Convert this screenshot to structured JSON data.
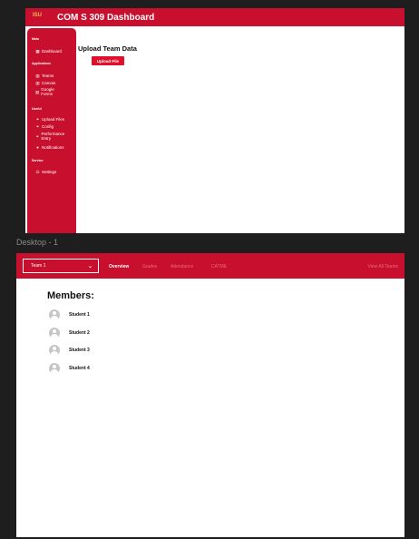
{
  "dashboard": {
    "logo_text": "ISU",
    "title": "COM S 309 Dashboard",
    "sidebar": {
      "sections": [
        {
          "label": "Main",
          "items": [
            {
              "icon": "grid-icon",
              "glyph": "▦",
              "label": "Dashboard"
            }
          ]
        },
        {
          "label": "Applications",
          "items": [
            {
              "icon": "bar-chart-icon",
              "glyph": "▥",
              "label": "Teams"
            },
            {
              "icon": "bar-chart-icon",
              "glyph": "▥",
              "label": "Canvas"
            },
            {
              "icon": "bar-chart-icon",
              "glyph": "▥",
              "label": "Google Forms"
            }
          ]
        },
        {
          "label": "Useful",
          "items": [
            {
              "icon": "link-icon",
              "glyph": "⚭",
              "label": "Upload Files"
            },
            {
              "icon": "link-icon",
              "glyph": "⚭",
              "label": "Config"
            },
            {
              "icon": "link-icon",
              "glyph": "⚭",
              "label": "Performance Entry"
            },
            {
              "icon": "bell-icon",
              "glyph": "●",
              "label": "Notifications"
            }
          ]
        },
        {
          "label": "Service",
          "items": [
            {
              "icon": "power-icon",
              "glyph": "⏻",
              "label": "Settings"
            }
          ]
        }
      ]
    },
    "main": {
      "heading": "Upload Team Data",
      "upload_button": "Upload File"
    }
  },
  "frame_label": "Desktop - 1",
  "team_view": {
    "team_select": "Team 1",
    "tabs": [
      {
        "label": "Overview",
        "active": true
      },
      {
        "label": "Grades",
        "active": false
      },
      {
        "label": "Attendance",
        "active": false
      },
      {
        "label": "CATME",
        "active": false
      }
    ],
    "view_all": "View All Teams",
    "members_title": "Members:",
    "members": [
      "Student 1",
      "Student 2",
      "Student 3",
      "Student 4"
    ]
  },
  "colors": {
    "brand_red": "#c8102e",
    "gold": "#f1be48",
    "canvas": "#1e1e1e"
  }
}
